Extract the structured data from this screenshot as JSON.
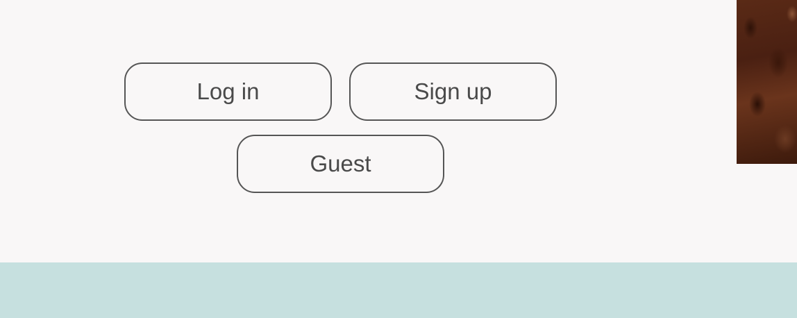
{
  "auth": {
    "login_label": "Log in",
    "signup_label": "Sign up",
    "guest_label": "Guest"
  },
  "colors": {
    "background": "#f9f7f7",
    "button_border": "#555555",
    "button_text": "#4a4a4a",
    "footer_band": "#c6e0df"
  }
}
